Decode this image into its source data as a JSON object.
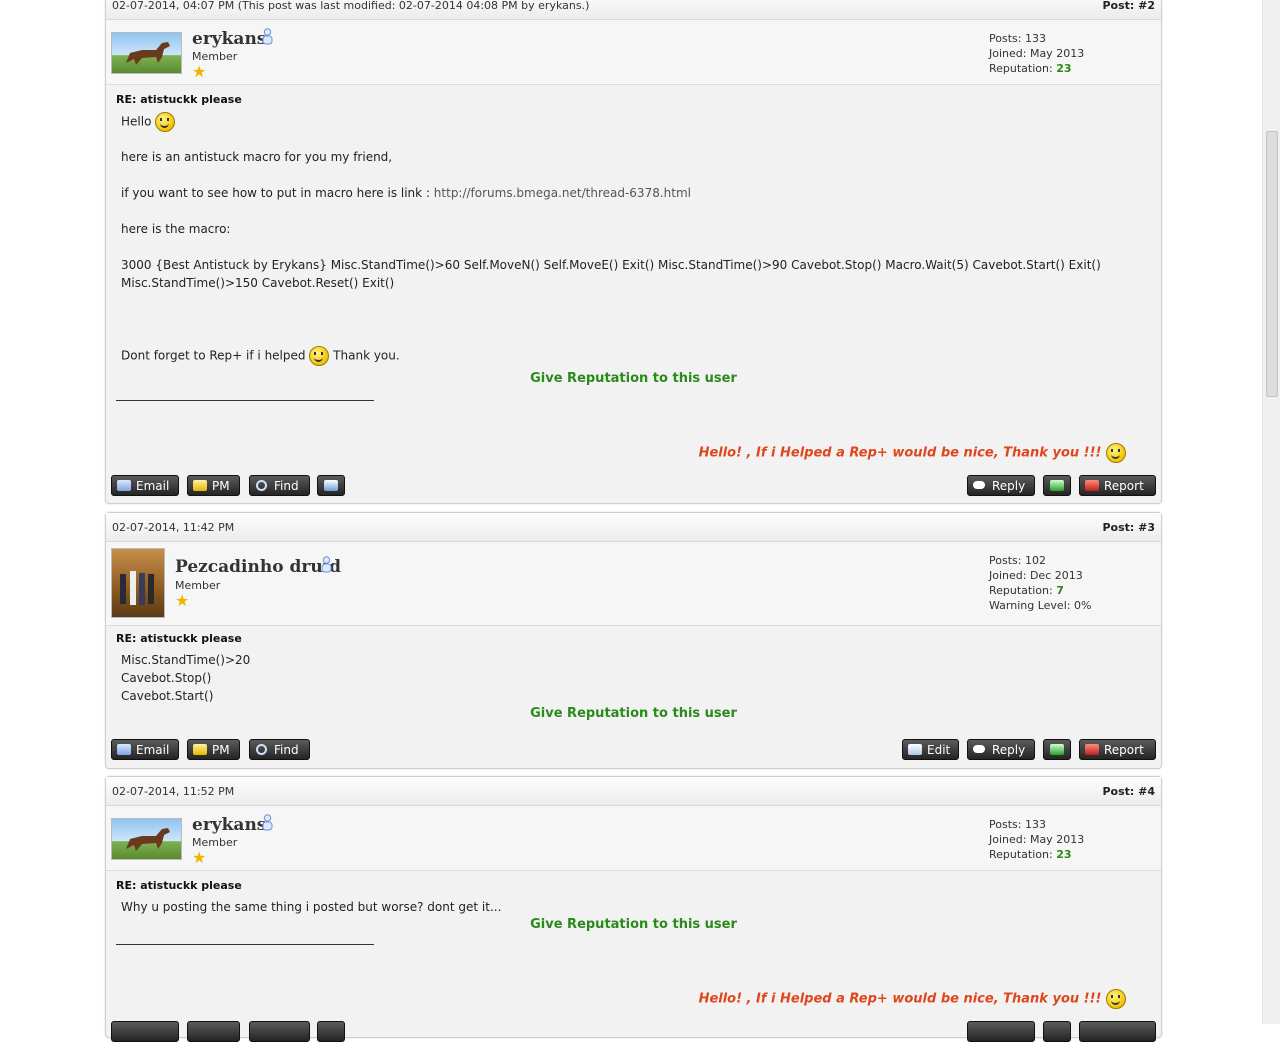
{
  "posts": [
    {
      "date": "02-07-2014, 04:07 PM (This post was last modified: 02-07-2014 04:08 PM by erykans.)",
      "post_label": "Post:",
      "post_number": "#2",
      "username": "erykans",
      "user_title": "Member",
      "stats": {
        "posts": "Posts: 133",
        "joined": "Joined: May 2013",
        "reputation_label": "Reputation:",
        "reputation_value": "23"
      },
      "subject": "RE: atistuckk please",
      "body_lines": {
        "l1": "Hello",
        "l2": "here is an antistuck macro for you my friend,",
        "l3": "if you want to see how to put in macro here is link :",
        "link": "http://forums.bmega.net/thread-6378.html",
        "l4": "here is the macro:",
        "l5": "3000 {Best Antistuck by Erykans} Misc.StandTime()>60 Self.MoveN() Self.MoveE() Exit() Misc.StandTime()>90 Cavebot.Stop() Macro.Wait(5) Cavebot.Start() Exit()",
        "l6": "Misc.StandTime()>150 Cavebot.Reset() Exit()",
        "l7a": "Dont forget to Rep+ if i helped",
        "l7b": "Thank you."
      },
      "give_rep": "Give Reputation to this user",
      "signature": "Hello! , If i Helped a Rep+ would be nice, Thank you !!!",
      "buttons": {
        "email": "Email",
        "pm": "PM",
        "find": "Find",
        "reply": "Reply",
        "report": "Report"
      }
    },
    {
      "date": "02-07-2014, 11:42 PM",
      "post_label": "Post:",
      "post_number": "#3",
      "username": "Pezcadinho druid",
      "user_title": "Member",
      "stats": {
        "posts": "Posts: 102",
        "joined": "Joined: Dec 2013",
        "reputation_label": "Reputation:",
        "reputation_value": "7",
        "warning": "Warning Level: 0%"
      },
      "subject": "RE: atistuckk please",
      "body_lines": {
        "l1": "Misc.StandTime()>20",
        "l2": "Cavebot.Stop()",
        "l3": "Cavebot.Start()"
      },
      "give_rep": "Give Reputation to this user",
      "buttons": {
        "email": "Email",
        "pm": "PM",
        "find": "Find",
        "edit": "Edit",
        "reply": "Reply",
        "report": "Report"
      }
    },
    {
      "date": "02-07-2014, 11:52 PM",
      "post_label": "Post:",
      "post_number": "#4",
      "username": "erykans",
      "user_title": "Member",
      "stats": {
        "posts": "Posts: 133",
        "joined": "Joined: May 2013",
        "reputation_label": "Reputation:",
        "reputation_value": "23"
      },
      "subject": "RE: atistuckk please",
      "body_lines": {
        "l1": "Why u posting the same thing i posted but worse? dont get it..."
      },
      "give_rep": "Give Reputation to this user",
      "signature": "Hello! , If i Helped a Rep+ would be nice, Thank you !!!"
    }
  ],
  "icons": [
    "online-status-icon",
    "star-icon",
    "smiley-icon",
    "mail-icon",
    "pm-icon",
    "find-icon",
    "user-icon",
    "reply-icon",
    "quote-icon",
    "report-icon",
    "edit-icon"
  ],
  "colors": {
    "reputation": "#2a8a1a",
    "signature": "#e0461c",
    "button": "#333333"
  }
}
